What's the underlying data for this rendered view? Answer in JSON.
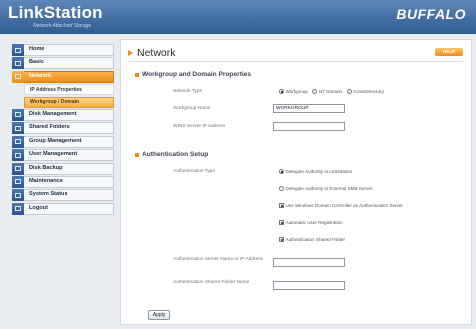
{
  "header": {
    "logo": "LinkStation",
    "tagline": "Network Attached Storage",
    "brand": "BUFFALO"
  },
  "sidebar": {
    "items": [
      {
        "label": "Home"
      },
      {
        "label": "Basic"
      },
      {
        "label": "Network"
      },
      {
        "label": "IP Address Properties"
      },
      {
        "label": "Workgroup / Domain"
      },
      {
        "label": "Disk Management"
      },
      {
        "label": "Shared Folders"
      },
      {
        "label": "Group Management"
      },
      {
        "label": "User Management"
      },
      {
        "label": "Disk Backup"
      },
      {
        "label": "Maintenance"
      },
      {
        "label": "System Status"
      },
      {
        "label": "Logout"
      }
    ]
  },
  "main": {
    "title": "Network",
    "help": "HELP",
    "workgroup": {
      "title": "Workgroup and Domain Properties",
      "network_type_label": "Network Type",
      "options": [
        "Workgroup",
        "NT Domain",
        "ActiveDirectory"
      ],
      "selected": "Workgroup",
      "workgroup_name_label": "Workgroup Name",
      "workgroup_name_value": "WORKGROUP",
      "wins_label": "WINS Server IP Address",
      "wins_value": ""
    },
    "auth": {
      "title": "Authentication Setup",
      "auth_type_label": "Authentication Type",
      "radio1": "Delegate Authority to LinkStation",
      "radio2": "Delegate Authority to External SMB Server",
      "check1": "Use Windows Domain Controller as Authentication Server",
      "check2": "Automatic User Registration",
      "check3": "Authentication Shared Folder",
      "server_label": "Authentication Server Name or IP Address",
      "server_value": "",
      "folder_label": "Authentication Shared Folder Name",
      "folder_value": ""
    },
    "apply": "Apply"
  },
  "colors": {
    "accent": "#f08a1a",
    "header": "#2e5c93",
    "nav_active": "#ef8d16"
  }
}
